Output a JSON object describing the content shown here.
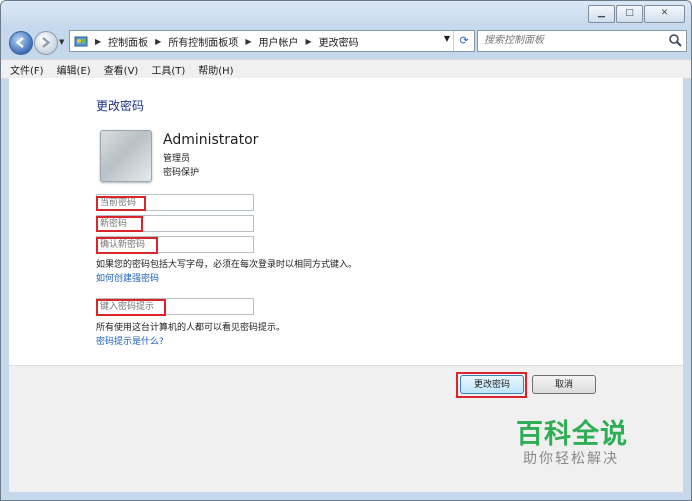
{
  "addressbar": {
    "crumbs": [
      "控制面板",
      "所有控制面板项",
      "用户帐户",
      "更改密码"
    ],
    "search_placeholder": "搜索控制面板"
  },
  "menu": [
    "文件(F)",
    "编辑(E)",
    "查看(V)",
    "工具(T)",
    "帮助(H)"
  ],
  "page": {
    "title": "更改密码",
    "user_name": "Administrator",
    "user_role": "管理员",
    "user_protection": "密码保护",
    "current_password_placeholder": "当前密码",
    "new_password_placeholder": "新密码",
    "confirm_password_placeholder": "确认新密码",
    "caps_note": "如果您的密码包括大写字母，必须在每次登录时以相同方式键入。",
    "strong_password_link": "如何创建强密码",
    "hint_placeholder": "键入密码提示",
    "hint_note": "所有使用这台计算机的人都可以看见密码提示。",
    "hint_link": "密码提示是什么?"
  },
  "buttons": {
    "change": "更改密码",
    "cancel": "取消"
  },
  "watermark": {
    "line1": "百科全说",
    "line2": "助你轻松解决"
  },
  "colors": {
    "highlight": "#d8262c",
    "link": "#1a5fb4",
    "title": "#1e3287"
  }
}
